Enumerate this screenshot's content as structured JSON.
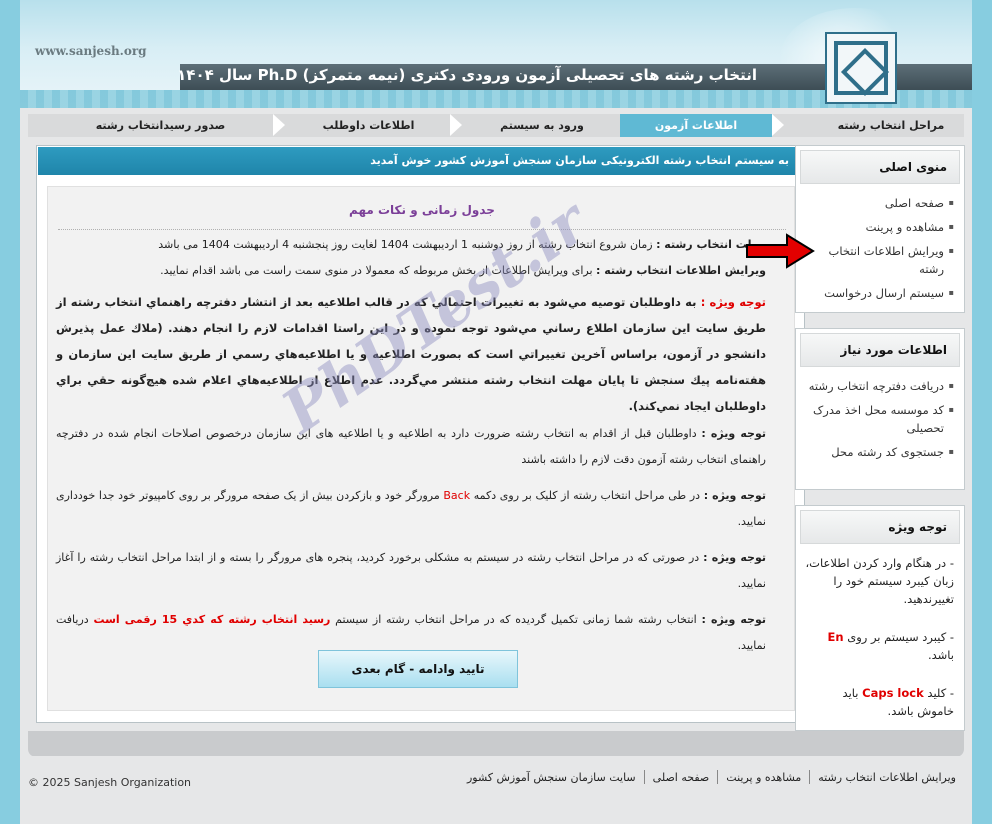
{
  "header": {
    "site_url": "www.sanjesh.org",
    "title": "انتخاب رشته های تحصیلی آزمون ورودی دکتری (نیمه متمرکز) Ph.D سال ۱۴۰۴"
  },
  "steps": [
    {
      "label": "مراحل انتخاب رشته",
      "active": false
    },
    {
      "label": "اطلاعات آزمون",
      "active": true
    },
    {
      "label": "ورود به سیستم",
      "active": false
    },
    {
      "label": "اطلاعات داوطلب",
      "active": false
    },
    {
      "label": "صدور رسیدانتخاب رشته",
      "active": false
    }
  ],
  "main": {
    "welcome": "به سیستم انتخاب رشته الکترونیکی سازمان سنجش آموزش کشور خوش آمدید",
    "section_title": "جدول زمانی و نکات مهم",
    "deadline_label": "مهلت انتخاب رشته :",
    "deadline_text": " زمان شروع انتخاب رشته از روز دوشنبه 1 اردیبهشت 1404 لغایت روز پنجشنبه 4 اردیبهشت 1404 می باشد",
    "edit_label": "ویرایش اطلاعات انتخاب رشته :",
    "edit_text": " برای ویرایش اطلاعات از بخش مربوطه که معمولا در منوی سمت راست می باشد اقدام نمایید.",
    "note_label": "توجه ویژه :",
    "note1_text": " به داوطلبان توصيه مي‌شود به تغييرات احتمالي كه در قالب اطلاعيه بعد از انتشار دفترچه راهنماي انتخاب رشته از طريق سايت اين سازمان اطلاع رساني مي‌شود توجه نموده و در اين راستا اقدامات لازم را انجام دهند. (ملاك عمل پذيرش دانشجو در آزمون، براساس آخرين تغييراتي است كه بصورت اطلاعيه و يا اطلاعيه‌هاي رسمي از طريق سايت اين سازمان و هفته‌نامه پيك سنجش تا پايان مهلت انتخاب رشته منتشر مي‌گردد. عدم اطلاع از اطلاعيه‌هاي اعلام شده هيچ‌گونه حقي براي داوطلبان ايجاد نمي‌كند).",
    "note2_text": " داوطلبان قبل از اقدام به انتخاب رشته ضرورت دارد به اطلاعیه و یا اطلاعیه های این سازمان درخصوص اصلاحات انجام شده در دفترچه راهنمای انتخاب رشته آزمون دقت لازم را داشته باشند",
    "note3_text_a": " در طی مراحل انتخاب رشته از کلیک بر روی دکمه ",
    "note3_back": "Back",
    "note3_text_b": " مرورگر خود و بازکردن بیش از یک صفحه مرورگر بر روی کامپیوتر خود جدا خودداری نمایید.",
    "note4_text": " در صورتی که در مراحل انتخاب رشته در سیستم به مشکلی برخورد کردید، پنجره های مرورگر را بسته و از ابتدا مراحل انتخاب رشته را آغاز نمایید.",
    "note5_text_a": " انتخاب رشته شما زمانی تکمیل گردیده که در مراحل انتخاب رشته از سیستم ",
    "note5_red": " رسيد انتخاب رشته كه كدي 15 رقمی است",
    "note5_text_b": " دریافت نمایید.",
    "next_button": "تایید وادامه - گام بعدی"
  },
  "sidebar": {
    "main_menu_title": "منوی اصلی",
    "main_menu": [
      "صفحه اصلی",
      "مشاهده و پرینت",
      "ویرایش اطلاعات انتخاب رشته",
      "سیستم ارسال درخواست"
    ],
    "needed_title": "اطلاعات مورد نیاز",
    "needed": [
      "دریافت دفترچه انتخاب رشته",
      "کد موسسه محل اخذ مدرک تحصیلی",
      "جستجوی کد رشته محل"
    ],
    "notice_title": "توجه ویژه",
    "notice1": "- در هنگام وارد کردن اطلاعات، زبان کیبرد سیستم خود را تغییرندهید.",
    "notice2_a": "- کیبرد سیستم بر روی ",
    "notice2_en": "En",
    "notice2_b": " باشد.",
    "notice3_a": "- کلید ",
    "notice3_caps": "Caps lock",
    "notice3_b": " باید خاموش باشد."
  },
  "footer": {
    "links": [
      "ویرایش اطلاعات انتخاب رشته",
      "مشاهده و پرینت",
      "صفحه اصلی",
      "سایت سازمان سنجش آموزش کشور"
    ],
    "copyright": "© 2025 Sanjesh Organization"
  },
  "watermark": "PhDTest.ir",
  "colors": {
    "accent": "#2e9bc0",
    "active_step": "#5fb9d4",
    "alert": "#e00000",
    "arrow": "#e30000"
  }
}
